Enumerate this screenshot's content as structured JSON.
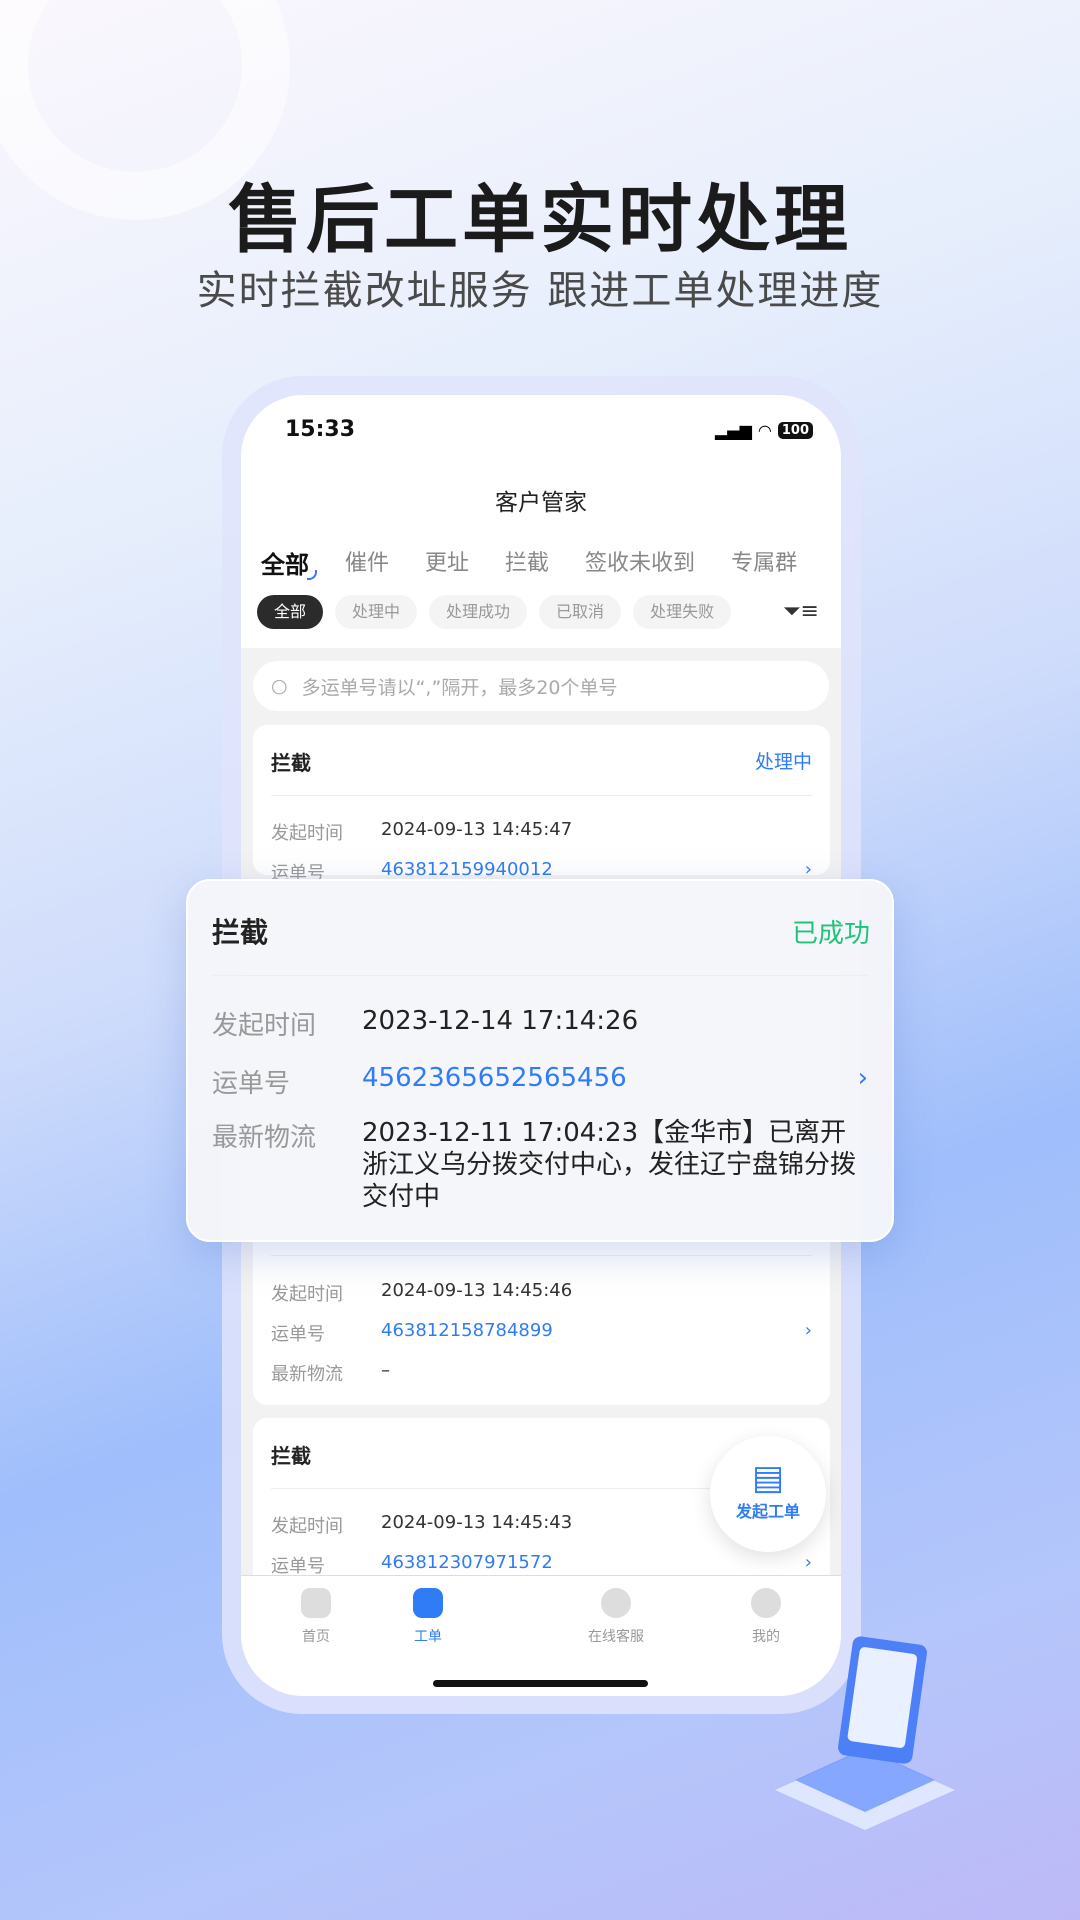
{
  "hero": {
    "title": "售后工单实时处理",
    "subtitle": "实时拦截改址服务  跟进工单处理进度"
  },
  "status_bar": {
    "time": "15:33",
    "battery": "100"
  },
  "header": {
    "title": "客户管家"
  },
  "tabs": [
    "全部",
    "催件",
    "更址",
    "拦截",
    "签收未收到",
    "专属群"
  ],
  "chips": [
    "全部",
    "处理中",
    "处理成功",
    "已取消",
    "处理失败"
  ],
  "search": {
    "placeholder": "多运单号请以“,”隔开，最多20个单号"
  },
  "labels": {
    "time": "发起时间",
    "waybill": "运单号",
    "logistics": "最新物流"
  },
  "cards": [
    {
      "type": "拦截",
      "status": "处理中",
      "time": "2024-09-13 14:45:47",
      "waybill": "463812159940012"
    },
    {
      "time": "2024-09-13 14:45:46",
      "waybill": "463812158784899",
      "logistics": "–"
    },
    {
      "type": "拦截",
      "time": "2024-09-13 14:45:43",
      "waybill": "463812307971572"
    }
  ],
  "overlay": {
    "type": "拦截",
    "status": "已成功",
    "time": "2023-12-14  17:14:26",
    "waybill": "4562365652565456",
    "logistics": "2023-12-11 17:04:23【金华市】已离开浙江义乌分拨交付中心，发往辽宁盘锦分拨交付中"
  },
  "fab": {
    "label": "发起工单"
  },
  "tabbar": [
    "首页",
    "工单",
    "在线客服",
    "我的"
  ],
  "colors": {
    "accent": "#2f7cf6",
    "success": "#1fc47a"
  }
}
